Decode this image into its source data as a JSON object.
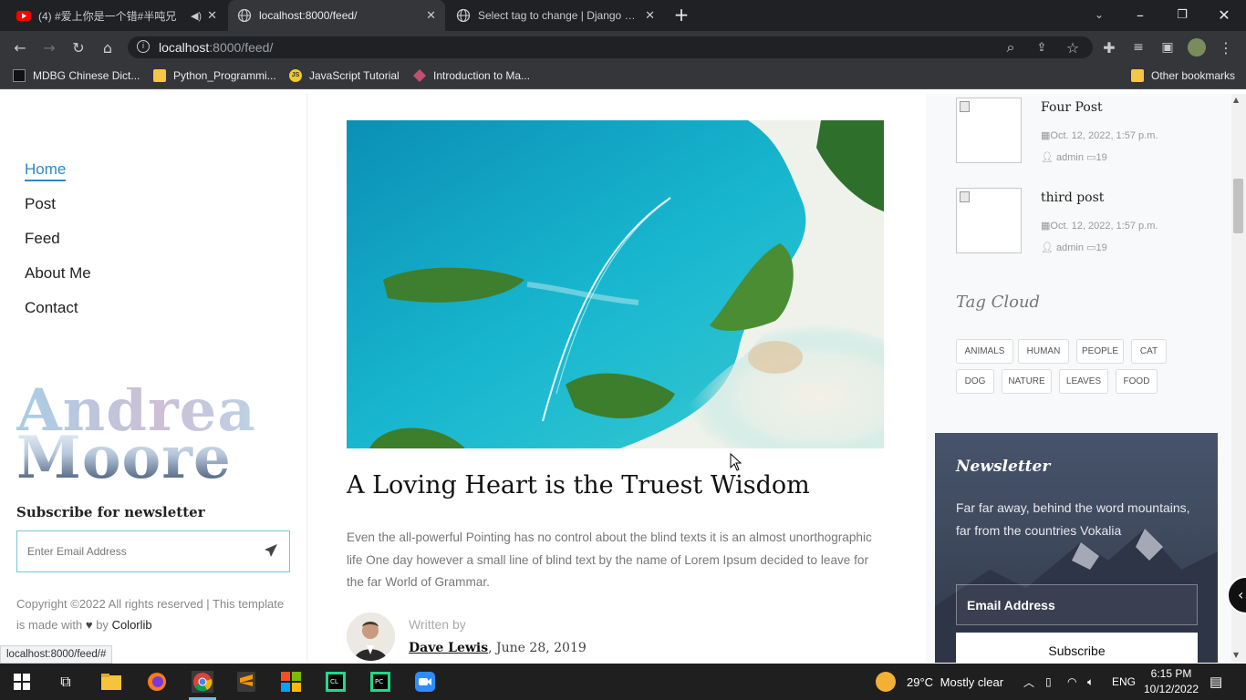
{
  "browser": {
    "tabs": [
      {
        "title": "(4) #爱上你是一个错#半吨兄"
      },
      {
        "title": "localhost:8000/feed/"
      },
      {
        "title": "Select tag to change | Django site"
      }
    ],
    "url_host": "localhost",
    "url_rest": ":8000/feed/",
    "bookmarks": [
      {
        "label": "MDBG Chinese Dict..."
      },
      {
        "label": "Python_Programmi..."
      },
      {
        "label": "JavaScript Tutorial"
      },
      {
        "label": "Introduction to Ma..."
      }
    ],
    "other_bookmarks": "Other bookmarks",
    "status_url": "localhost:8000/feed/#"
  },
  "nav": {
    "items": [
      {
        "label": "Home",
        "active": true
      },
      {
        "label": "Post"
      },
      {
        "label": "Feed"
      },
      {
        "label": "About Me"
      },
      {
        "label": "Contact"
      }
    ]
  },
  "logo": {
    "line1": "Andrea",
    "line2": "Moore"
  },
  "left_newsletter": {
    "title": "Subscribe for newsletter",
    "placeholder": "Enter Email Address",
    "copyright_pre": "Copyright ©2022 All rights reserved | This template is made with ",
    "copyright_by": " by ",
    "brand": "Colorlib"
  },
  "post": {
    "title": "A Loving Heart is the Truest Wisdom",
    "body": "Even the all-powerful Pointing has no control about the blind texts it is an almost unorthographic life One day however a small line of blind text by the name of Lorem Ipsum decided to leave for the far World of Grammar.",
    "written_by": "Written by",
    "author": "Dave Lewis",
    "date": ", June 28, 2019"
  },
  "recent_posts": [
    {
      "title": "Four Post",
      "date": "Oct. 12, 2022, 1:57 p.m.",
      "author": "admin",
      "comments": "19"
    },
    {
      "title": "third post",
      "date": "Oct. 12, 2022, 1:57 p.m.",
      "author": "admin",
      "comments": "19"
    }
  ],
  "tag_cloud": {
    "title": "Tag Cloud",
    "tags": [
      "ANIMALS",
      "HUMAN",
      "PEOPLE",
      "CAT",
      "DOG",
      "NATURE",
      "LEAVES",
      "FOOD"
    ]
  },
  "newsletter": {
    "title": "Newsletter",
    "text": "Far far away, behind the word mountains, far from the countries Vokalia",
    "input": "Email Address",
    "button": "Subscribe"
  },
  "taskbar": {
    "temp": "29°C",
    "weather": "Mostly clear",
    "lang": "ENG",
    "time": "6:15 PM",
    "date": "10/12/2022"
  }
}
